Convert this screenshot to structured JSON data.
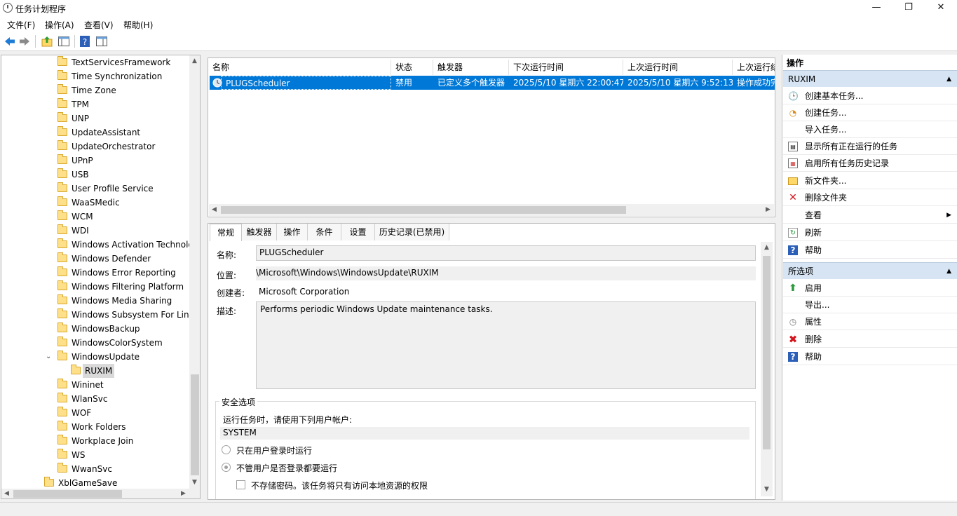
{
  "window": {
    "title": "任务计划程序",
    "controls": {
      "minimize": "—",
      "maximize": "❐",
      "close": "✕"
    }
  },
  "menu": [
    "文件(F)",
    "操作(A)",
    "查看(V)",
    "帮助(H)"
  ],
  "tree": {
    "items": [
      {
        "label": "TextServicesFramework"
      },
      {
        "label": "Time Synchronization"
      },
      {
        "label": "Time Zone"
      },
      {
        "label": "TPM"
      },
      {
        "label": "UNP"
      },
      {
        "label": "UpdateAssistant"
      },
      {
        "label": "UpdateOrchestrator"
      },
      {
        "label": "UPnP"
      },
      {
        "label": "USB"
      },
      {
        "label": "User Profile Service"
      },
      {
        "label": "WaaSMedic"
      },
      {
        "label": "WCM"
      },
      {
        "label": "WDI"
      },
      {
        "label": "Windows Activation Technolo"
      },
      {
        "label": "Windows Defender"
      },
      {
        "label": "Windows Error Reporting"
      },
      {
        "label": "Windows Filtering Platform"
      },
      {
        "label": "Windows Media Sharing"
      },
      {
        "label": "Windows Subsystem For Linu"
      },
      {
        "label": "WindowsBackup"
      },
      {
        "label": "WindowsColorSystem"
      },
      {
        "label": "WindowsUpdate"
      },
      {
        "label": "RUXIM"
      },
      {
        "label": "Wininet"
      },
      {
        "label": "WlanSvc"
      },
      {
        "label": "WOF"
      },
      {
        "label": "Work Folders"
      },
      {
        "label": "Workplace Join"
      },
      {
        "label": "WS"
      },
      {
        "label": "WwanSvc"
      },
      {
        "label": "XblGameSave"
      }
    ]
  },
  "task_list": {
    "columns": [
      "名称",
      "状态",
      "触发器",
      "下次运行时间",
      "上次运行时间",
      "上次运行结"
    ],
    "rows": [
      {
        "name": "PLUGScheduler",
        "status": "禁用",
        "trigger": "已定义多个触发器",
        "next_run": "2025/5/10 星期六 22:00:47",
        "last_run": "2025/5/10 星期六 9:52:13",
        "last_result": "操作成功完"
      }
    ]
  },
  "detail": {
    "tabs": [
      "常规",
      "触发器",
      "操作",
      "条件",
      "设置",
      "历史记录(已禁用)"
    ],
    "name_label": "名称:",
    "name_value": "PLUGScheduler",
    "location_label": "位置:",
    "location_value": "\\Microsoft\\Windows\\WindowsUpdate\\RUXIM",
    "author_label": "创建者:",
    "author_value": "Microsoft Corporation",
    "desc_label": "描述:",
    "desc_value": "Performs periodic Windows Update maintenance tasks.",
    "security": {
      "legend": "安全选项",
      "run_as_text": "运行任务时，请使用下列用户帐户:",
      "account": "SYSTEM",
      "option_logged_on": "只在用户登录时运行",
      "option_always": "不管用户是否登录都要运行",
      "option_no_password": "不存储密码。该任务将只有访问本地资源的权限"
    }
  },
  "actions": {
    "header": "操作",
    "section1": {
      "title": "RUXIM",
      "items": [
        "创建基本任务...",
        "创建任务...",
        "导入任务...",
        "显示所有正在运行的任务",
        "启用所有任务历史记录",
        "新文件夹...",
        "删除文件夹",
        "查看",
        "刷新",
        "帮助"
      ]
    },
    "section2": {
      "title": "所选项",
      "items": [
        "启用",
        "导出...",
        "属性",
        "删除",
        "帮助"
      ]
    }
  },
  "colors": {
    "selection": "#0078d7",
    "section_header": "#d6e4f3"
  }
}
